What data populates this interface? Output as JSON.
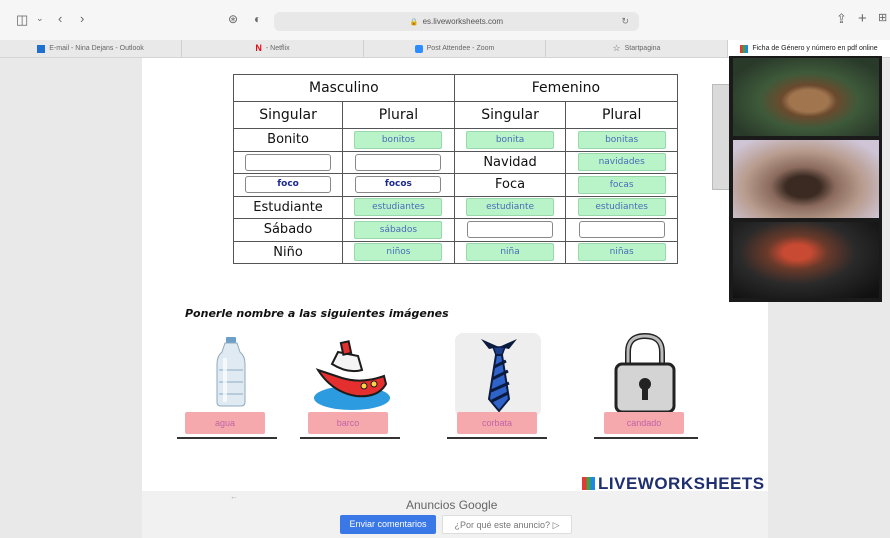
{
  "browser": {
    "url": "es.liveworksheets.com",
    "tabs": [
      {
        "label": "E-mail - Nina Dejans - Outlook"
      },
      {
        "label": "- Netflix"
      },
      {
        "label": "Post Attendee - Zoom"
      },
      {
        "label": "Startpagina"
      },
      {
        "label": "Ficha de Género y número en pdf online"
      }
    ]
  },
  "table": {
    "group_headers": [
      "Masculino",
      "Femenino"
    ],
    "sub_headers": [
      "Singular",
      "Plural",
      "Singular",
      "Plural"
    ],
    "rows": [
      [
        {
          "type": "text",
          "value": "Bonito"
        },
        {
          "type": "answer",
          "value": "bonitos"
        },
        {
          "type": "answer",
          "value": "bonita"
        },
        {
          "type": "answer",
          "value": "bonitas"
        }
      ],
      [
        {
          "type": "blank",
          "value": ""
        },
        {
          "type": "blank",
          "value": ""
        },
        {
          "type": "text",
          "value": "Navidad"
        },
        {
          "type": "answer",
          "value": "navidades"
        }
      ],
      [
        {
          "type": "blank",
          "value": "foco"
        },
        {
          "type": "blank",
          "value": "focos"
        },
        {
          "type": "text",
          "value": "Foca"
        },
        {
          "type": "answer",
          "value": "focas"
        }
      ],
      [
        {
          "type": "text",
          "value": "Estudiante"
        },
        {
          "type": "answer",
          "value": "estudiantes"
        },
        {
          "type": "answer",
          "value": "estudiante"
        },
        {
          "type": "answer",
          "value": "estudiantes"
        }
      ],
      [
        {
          "type": "text",
          "value": "Sábado"
        },
        {
          "type": "answer",
          "value": "sábados"
        },
        {
          "type": "blank",
          "value": ""
        },
        {
          "type": "blank",
          "value": ""
        }
      ],
      [
        {
          "type": "text",
          "value": "Niño"
        },
        {
          "type": "answer",
          "value": "niños"
        },
        {
          "type": "answer",
          "value": "niña"
        },
        {
          "type": "answer",
          "value": "niñas"
        }
      ]
    ]
  },
  "instruction": "Ponerle nombre a las siguientes imágenes",
  "pictures": [
    {
      "icon": "water-bottle-icon",
      "answer": "agua"
    },
    {
      "icon": "boat-icon",
      "answer": "barco"
    },
    {
      "icon": "tie-icon",
      "answer": "corbata"
    },
    {
      "icon": "padlock-icon",
      "answer": "candado"
    }
  ],
  "logo": "LIVEWORKSHEETS",
  "ads": {
    "title": "Anuncios Google",
    "feedback_button": "Enviar comentarios",
    "why_button": "¿Por qué este anuncio? ▷"
  }
}
